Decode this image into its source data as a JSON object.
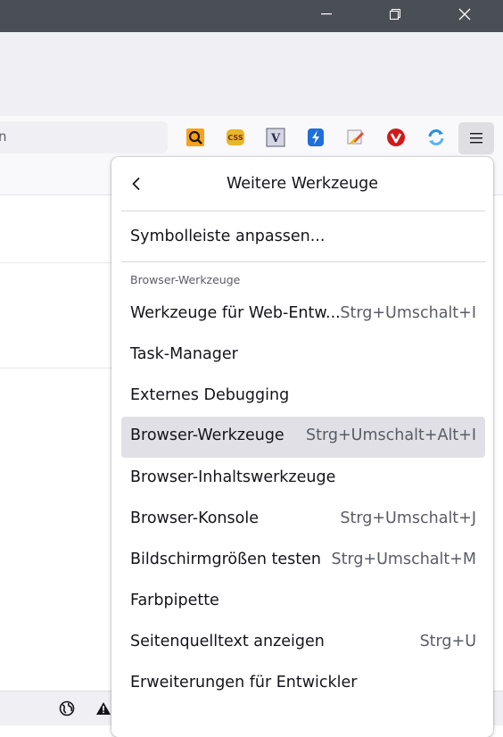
{
  "urlbar": {
    "fragment": "n"
  },
  "toolbar_extensions": [
    {
      "name": "search-ext-icon",
      "color": "#f7a21b"
    },
    {
      "name": "css-ext-icon",
      "color": "#e8b629"
    },
    {
      "name": "v-ext-icon",
      "color": "#d0d0dc"
    },
    {
      "name": "bolt-ext-icon",
      "color": "#1e6fd9"
    },
    {
      "name": "edit-ext-icon",
      "color": "#e24b3b"
    },
    {
      "name": "vivaldi-ext-icon",
      "color": "#d01a1a"
    },
    {
      "name": "sync-ext-icon",
      "color": "#2a8fe0"
    }
  ],
  "panel": {
    "title": "Weitere Werkzeuge",
    "customize": "Symbolleiste anpassen...",
    "section_label": "Browser-Werkzeuge",
    "items": [
      {
        "label": "Werkzeuge für Web-Entw...",
        "shortcut": "Strg+Umschalt+I"
      },
      {
        "label": "Task-Manager",
        "shortcut": ""
      },
      {
        "label": "Externes Debugging",
        "shortcut": ""
      },
      {
        "label": "Browser-Werkzeuge",
        "shortcut": "Strg+Umschalt+Alt+I"
      },
      {
        "label": "Browser-Inhaltswerkzeuge",
        "shortcut": ""
      },
      {
        "label": "Browser-Konsole",
        "shortcut": "Strg+Umschalt+J"
      },
      {
        "label": "Bildschirmgrößen testen",
        "shortcut": "Strg+Umschalt+M"
      },
      {
        "label": "Farbpipette",
        "shortcut": ""
      },
      {
        "label": "Seitenquelltext anzeigen",
        "shortcut": "Strg+U"
      },
      {
        "label": "Erweiterungen für Entwickler",
        "shortcut": ""
      }
    ],
    "highlighted_item": "Browser-Werkzeuge"
  },
  "colors": {
    "titlebar": "#4a4e55",
    "highlight": "#e0e0e6"
  }
}
